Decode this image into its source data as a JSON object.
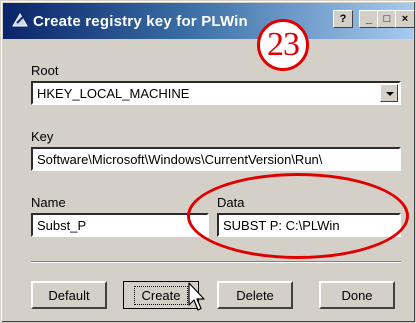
{
  "window": {
    "title": "Create registry key for PLWin"
  },
  "callout": {
    "number": "23"
  },
  "colors": {
    "annotation": "#e00000",
    "titlebar_start": "#0a246a",
    "titlebar_end": "#a6caf0",
    "face": "#d4d0c8"
  },
  "titlebar_buttons": {
    "help": "?",
    "minimize": "_",
    "maximize": "□",
    "close": "×"
  },
  "root": {
    "label": "Root",
    "value": "HKEY_LOCAL_MACHINE"
  },
  "key": {
    "label": "Key",
    "value": "Software\\Microsoft\\Windows\\CurrentVersion\\Run\\"
  },
  "name": {
    "label": "Name",
    "value": "Subst_P"
  },
  "data": {
    "label": "Data",
    "value": "SUBST P: C:\\PLWin"
  },
  "buttons": {
    "default": "Default",
    "create": "Create",
    "delete": "Delete",
    "done": "Done"
  },
  "icons": {
    "app": "plwin-app-icon",
    "cursor": "mouse-pointer-icon",
    "dropdown": "chevron-down-icon"
  }
}
